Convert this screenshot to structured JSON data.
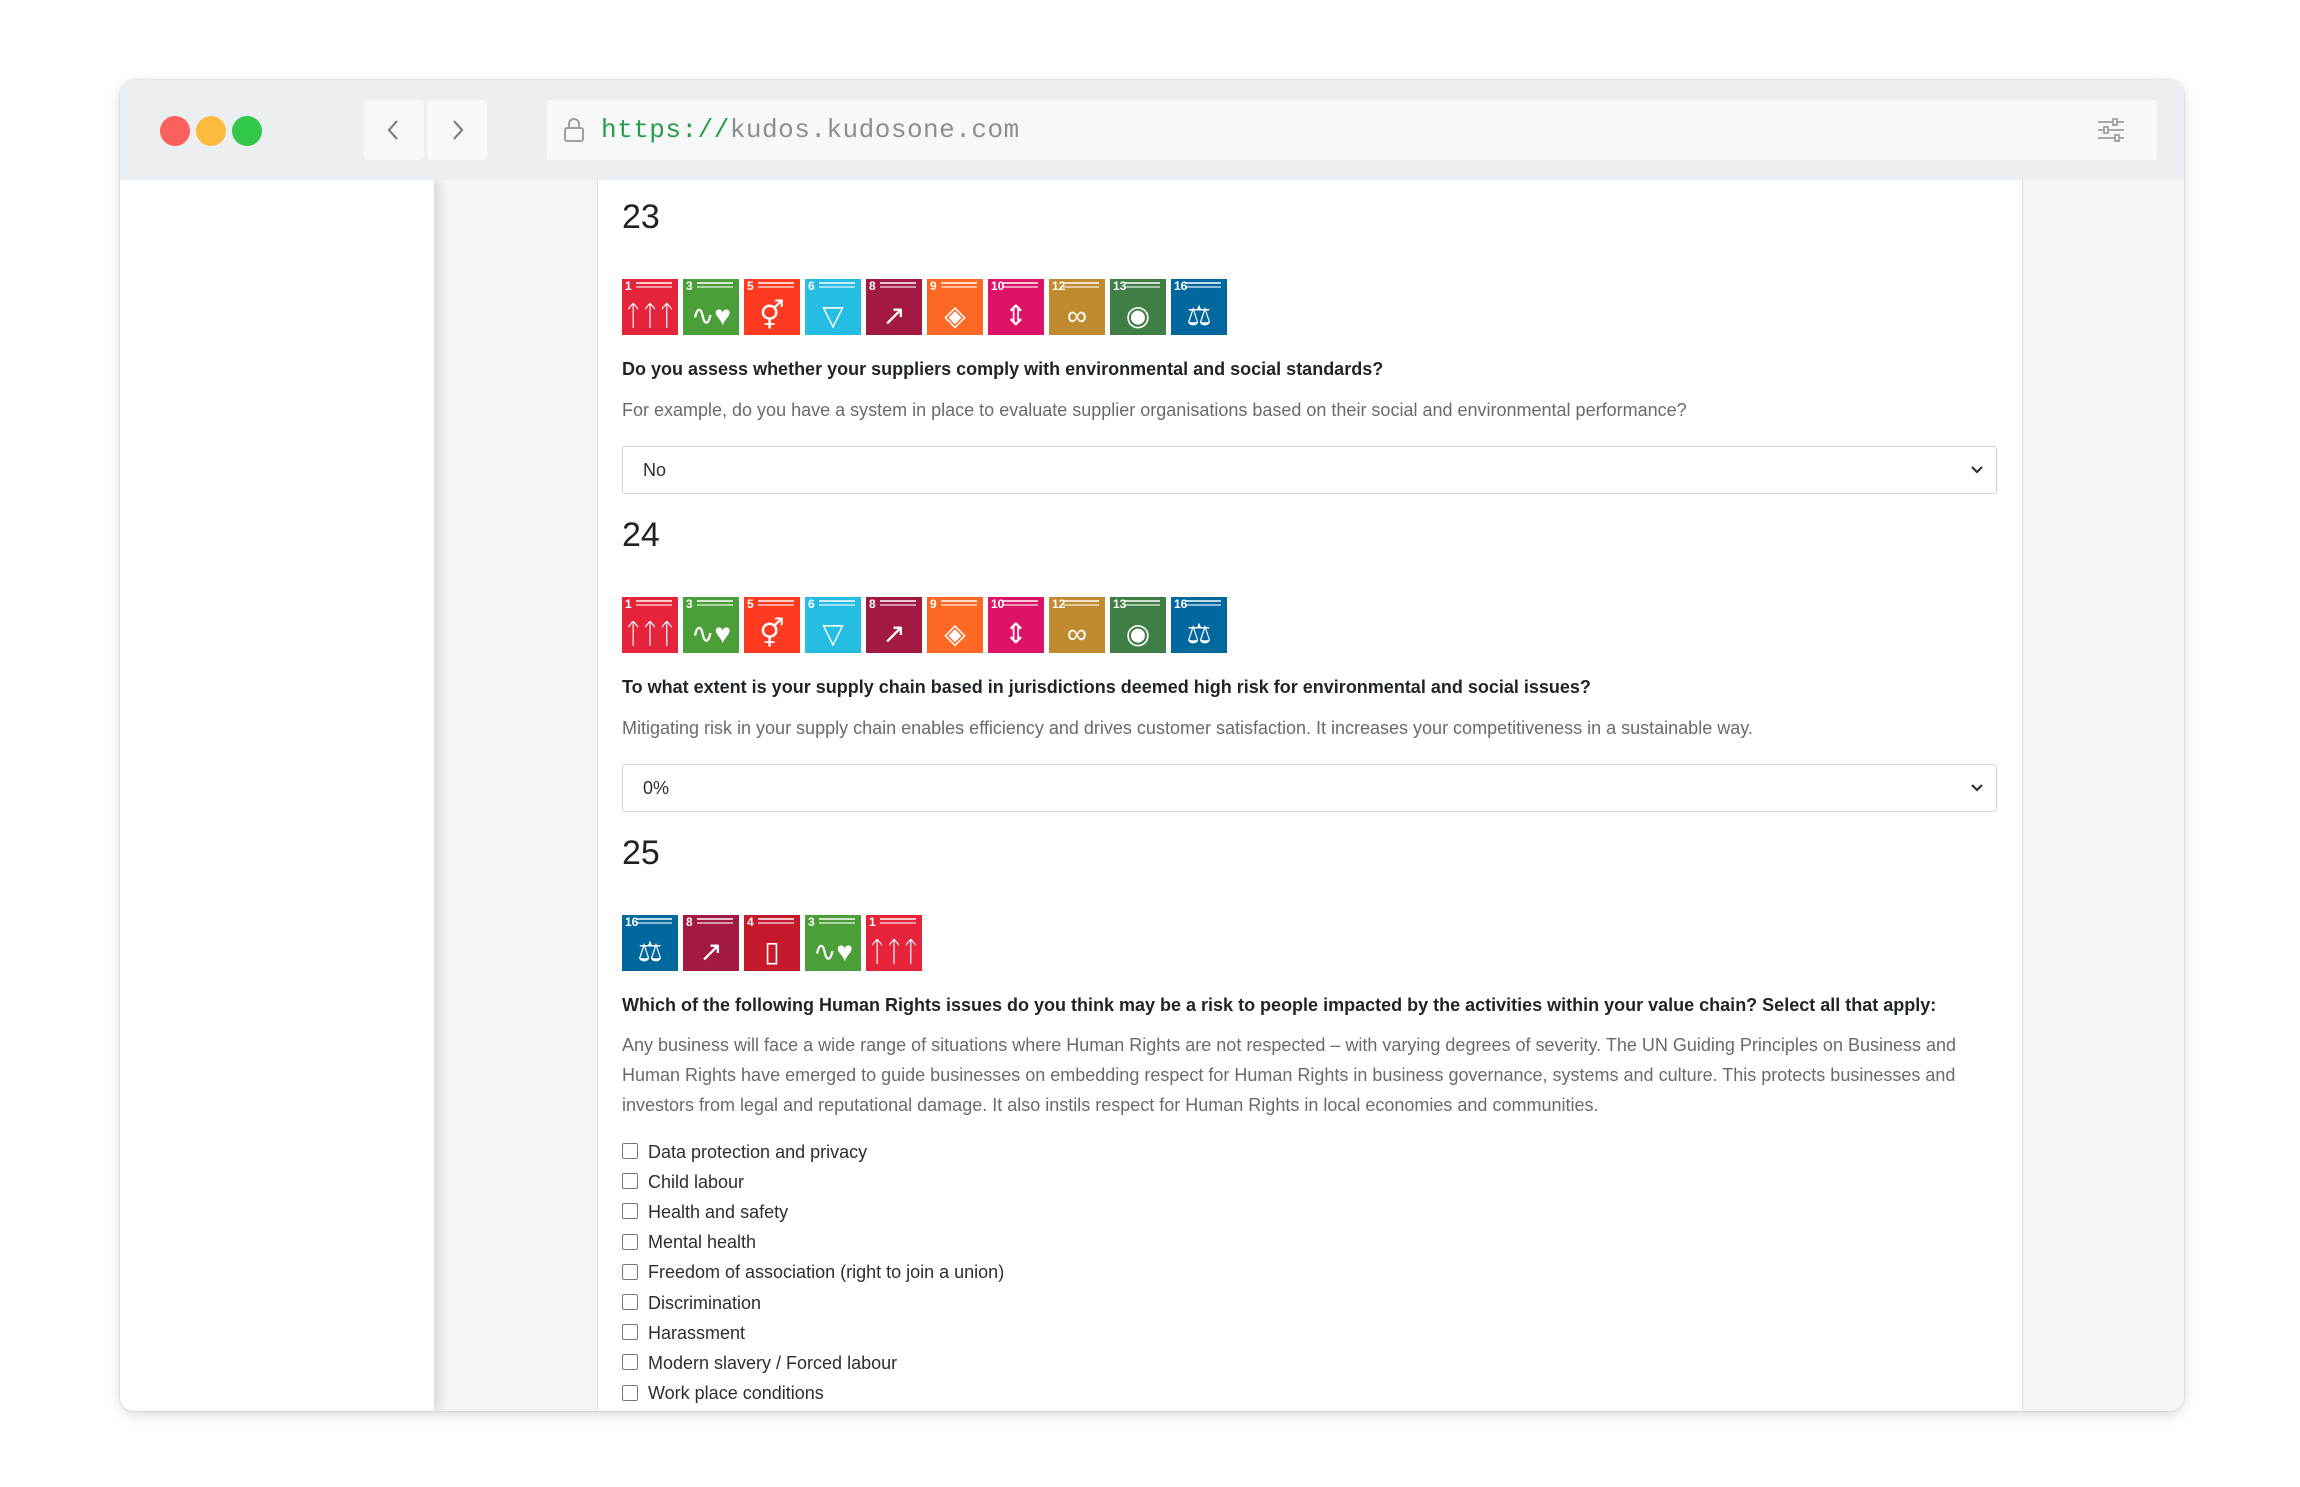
{
  "browser": {
    "url_protocol": "https://",
    "url_host": "kudos.kudosone.com"
  },
  "questions": [
    {
      "number": "23",
      "sdgs": [
        1,
        3,
        5,
        6,
        8,
        9,
        10,
        12,
        13,
        16
      ],
      "title": "Do you assess whether your suppliers comply with environmental and social standards?",
      "description": "For example, do you have a system in place to evaluate supplier organisations based on their social and environmental performance?",
      "selected": "No"
    },
    {
      "number": "24",
      "sdgs": [
        1,
        3,
        5,
        6,
        8,
        9,
        10,
        12,
        13,
        16
      ],
      "title": "To what extent is your supply chain based in jurisdictions deemed high risk for environmental and social issues?",
      "description": "Mitigating risk in your supply chain enables efficiency and drives customer satisfaction. It increases your competitiveness in a sustainable way.",
      "selected": "0%"
    },
    {
      "number": "25",
      "sdgs": [
        16,
        8,
        4,
        3,
        1
      ],
      "title": "Which of the following Human Rights issues do you think may be a risk to people impacted by the activities within your value chain? Select all that apply:",
      "description": "Any business will face a wide range of situations where Human Rights are not respected – with varying degrees of severity. The UN Guiding Principles on Business and Human Rights have emerged to guide businesses on embedding respect for Human Rights in business governance, systems and culture. This protects businesses and investors from legal and reputational damage. It also instils respect for Human Rights in local economies and communities.",
      "options": [
        "Data protection and privacy",
        "Child labour",
        "Health and safety",
        "Mental health",
        "Freedom of association (right to join a union)",
        "Discrimination",
        "Harassment",
        "Modern slavery / Forced labour",
        "Work place conditions"
      ]
    }
  ],
  "sdg_icon_names": {
    "1": "no-poverty-icon",
    "3": "good-health-icon",
    "4": "quality-education-icon",
    "5": "gender-equality-icon",
    "6": "clean-water-icon",
    "8": "decent-work-icon",
    "9": "industry-innovation-icon",
    "10": "reduced-inequalities-icon",
    "12": "responsible-consumption-icon",
    "13": "climate-action-icon",
    "16": "peace-justice-icon"
  },
  "sdg_colors": {
    "1": "#e5243b",
    "3": "#4c9f38",
    "4": "#c5192d",
    "5": "#ff3a21",
    "6": "#26bde2",
    "8": "#a21942",
    "9": "#fd6925",
    "10": "#dd1367",
    "12": "#bf8b2e",
    "13": "#3f7e44",
    "16": "#00689d"
  }
}
